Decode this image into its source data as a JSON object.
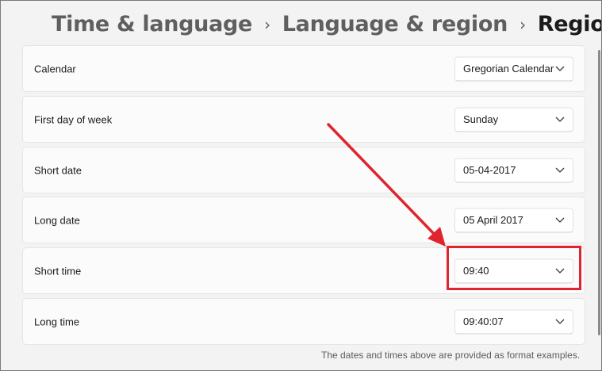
{
  "breadcrumb": {
    "items": [
      "Time & language",
      "Language & region",
      "Regional format"
    ],
    "separator": "›"
  },
  "settings": [
    {
      "label": "Calendar",
      "value": "Gregorian Calendar"
    },
    {
      "label": "First day of week",
      "value": "Sunday"
    },
    {
      "label": "Short date",
      "value": "05-04-2017"
    },
    {
      "label": "Long date",
      "value": "05 April 2017"
    },
    {
      "label": "Short time",
      "value": "09:40"
    },
    {
      "label": "Long time",
      "value": "09:40:07"
    }
  ],
  "footnote": "The dates and times above are provided as format examples.",
  "annotation": {
    "color": "#e0242e",
    "highlighted_setting": "Short time"
  },
  "icons": {
    "dropdown": "chevron-down-icon",
    "separator": "chevron-right-icon"
  }
}
